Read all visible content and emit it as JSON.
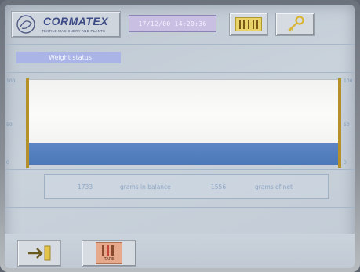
{
  "header": {
    "brand": "CORMATEX",
    "tagline": "TEXTILE MACHINERY AND PLANTS",
    "datetime": "17/12/00 14:20:36",
    "units_button_icon": "barcode-icon",
    "settings_button_icon": "key-icon"
  },
  "weight": {
    "label": "Weight status",
    "fill_fraction": 0.27,
    "scale_ticks": [
      "100",
      "50",
      "0"
    ]
  },
  "readout": {
    "value_1": "1733",
    "label_1": "grams in balance",
    "value_2": "1556",
    "label_2": "grams of net"
  },
  "footer": {
    "exit_icon": "exit-arrow-icon",
    "tare_icon": "tare-icon",
    "tare_label": "TARE"
  },
  "colors": {
    "bar_fill": "#4b78b8",
    "bar_edge": "#b5912a",
    "label_bg": "#aab4e6"
  }
}
